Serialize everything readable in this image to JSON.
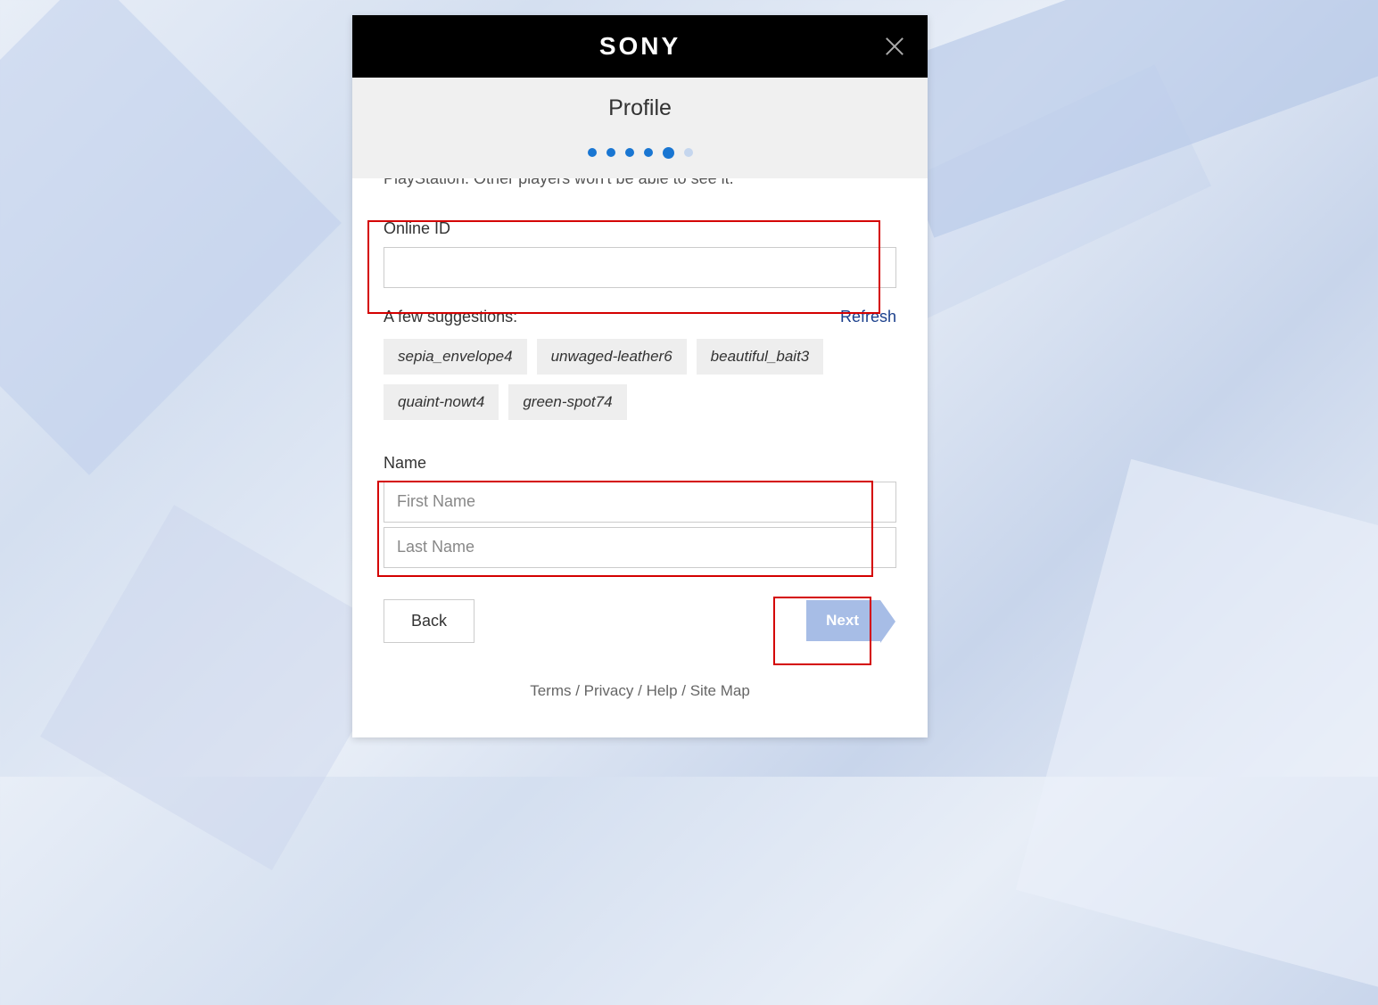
{
  "header": {
    "brand": "SONY",
    "title": "Profile"
  },
  "progress": {
    "total": 6,
    "active_index": 4
  },
  "truncated_line": "PlayStation. Other players won't be able to see it.",
  "online_id": {
    "label": "Online ID",
    "value": ""
  },
  "suggestions": {
    "label": "A few suggestions:",
    "refresh": "Refresh",
    "items": [
      "sepia_envelope4",
      "unwaged-leather6",
      "beautiful_bait3",
      "quaint-nowt4",
      "green-spot74"
    ]
  },
  "name": {
    "label": "Name",
    "first_placeholder": "First Name",
    "last_placeholder": "Last Name",
    "first_value": "",
    "last_value": ""
  },
  "actions": {
    "back": "Back",
    "next": "Next"
  },
  "footer": {
    "terms": "Terms",
    "privacy": "Privacy",
    "help": "Help",
    "sitemap": "Site Map",
    "sep": " / "
  }
}
